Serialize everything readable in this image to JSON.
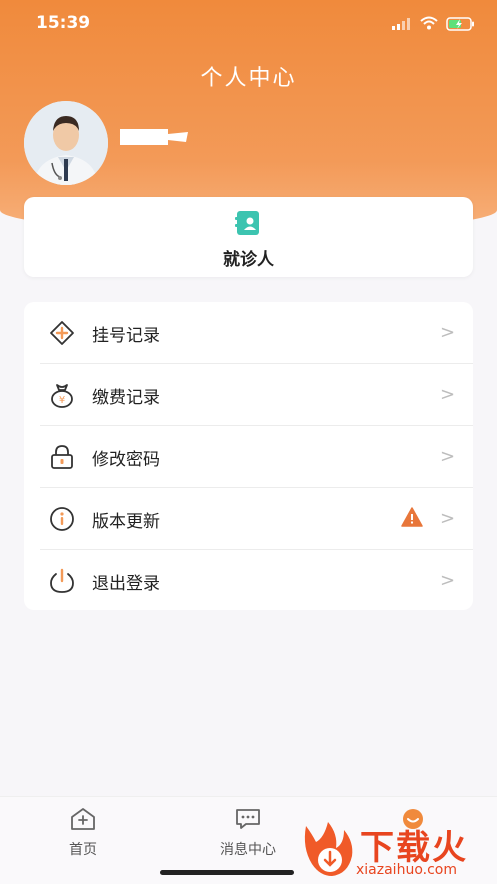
{
  "status_bar": {
    "time": "15:39"
  },
  "header": {
    "title": "个人中心"
  },
  "visit_card": {
    "label": "就诊人"
  },
  "menu": {
    "items": [
      {
        "label": "挂号记录",
        "icon": "register-icon"
      },
      {
        "label": "缴费记录",
        "icon": "payment-bag-icon"
      },
      {
        "label": "修改密码",
        "icon": "lock-icon"
      },
      {
        "label": "版本更新",
        "icon": "info-icon",
        "badge": "warning-icon"
      },
      {
        "label": "退出登录",
        "icon": "power-icon"
      }
    ]
  },
  "tabbar": {
    "tabs": [
      {
        "label": "首页"
      },
      {
        "label": "消息中心"
      },
      {
        "label": ""
      }
    ]
  },
  "watermark": {
    "text": "下载火",
    "url": "xiazaihuo.com"
  },
  "colors": {
    "accent": "#f08a3c",
    "teal": "#3cc4b0",
    "warning": "#e8763a"
  }
}
